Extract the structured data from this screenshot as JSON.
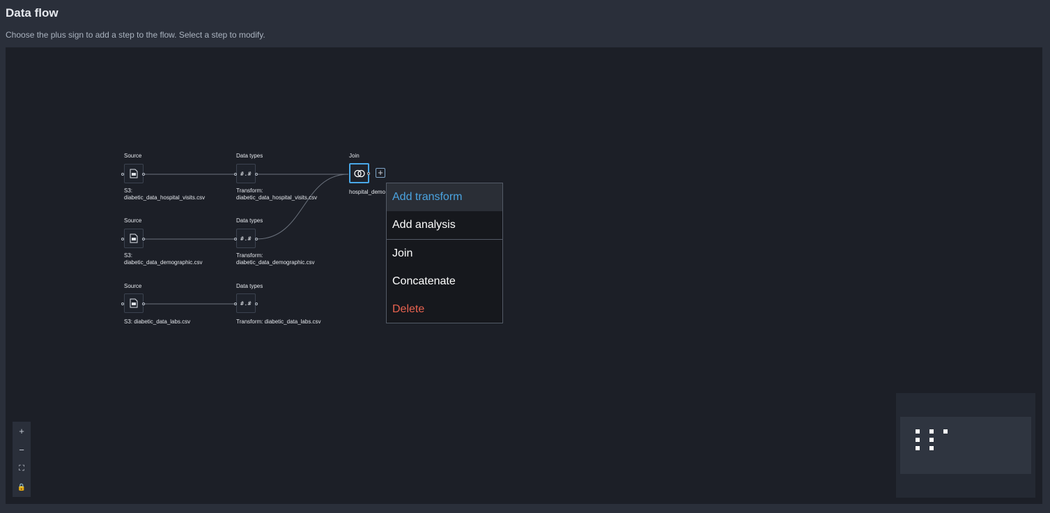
{
  "header": {
    "title": "Data flow",
    "subtitle": "Choose the plus sign to add a step to the flow. Select a step to modify."
  },
  "nodes": {
    "source_1": {
      "header": "Source",
      "caption_line1": "S3:",
      "caption_line2": "diabetic_data_hospital_visits.csv"
    },
    "source_2": {
      "header": "Source",
      "caption_line1": "S3:",
      "caption_line2": "diabetic_data_demographic.csv"
    },
    "source_3": {
      "header": "Source",
      "caption_line1": "S3: diabetic_data_labs.csv"
    },
    "dtype_1": {
      "header": "Data types",
      "glyph": "#.#",
      "caption_line1": "Transform:",
      "caption_line2": "diabetic_data_hospital_visits.csv"
    },
    "dtype_2": {
      "header": "Data types",
      "glyph": "#.#",
      "caption_line1": "Transform:",
      "caption_line2": "diabetic_data_demographic.csv"
    },
    "dtype_3": {
      "header": "Data types",
      "glyph": "#.#",
      "caption_line1": "Transform: diabetic_data_labs.csv"
    },
    "join": {
      "header": "Join",
      "caption": "hospital_demo"
    }
  },
  "add_step_label": "+",
  "context_menu": {
    "items": [
      {
        "label": "Add transform",
        "state": "hover"
      },
      {
        "label": "Add analysis"
      },
      {
        "label": "Join"
      },
      {
        "label": "Concatenate"
      },
      {
        "label": "Delete",
        "style": "danger"
      }
    ]
  },
  "zoom_controls": {
    "zoom_in": "+",
    "zoom_out": "−",
    "fit_view": "⛶",
    "lock": "🔒"
  },
  "colors": {
    "accent": "#4aa8e8",
    "danger": "#e8624f",
    "canvas": "#1c1f27"
  }
}
